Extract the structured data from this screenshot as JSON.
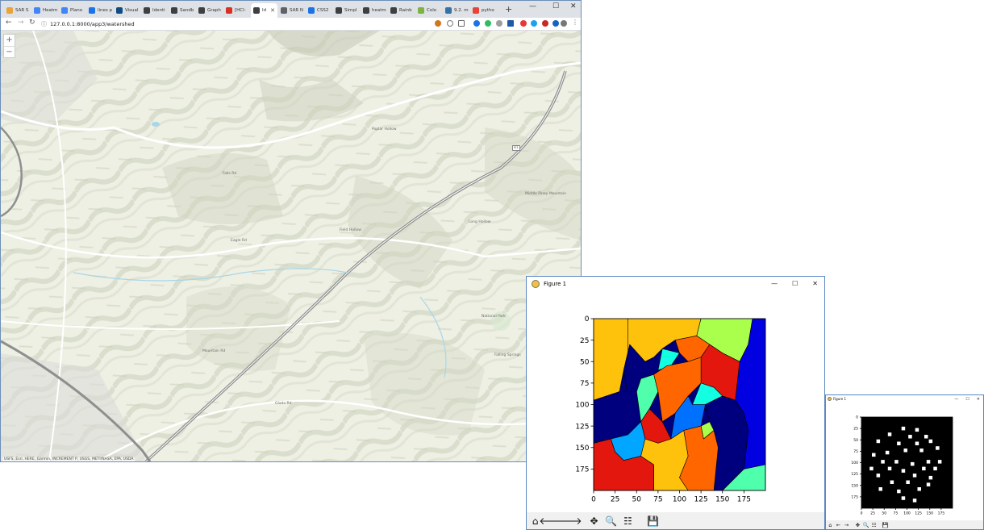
{
  "browser": {
    "tabs": [
      {
        "label": "SAR S",
        "color": "#e8a33b"
      },
      {
        "label": "Heatm",
        "color": "#4285f4"
      },
      {
        "label": "Plano",
        "color": "#4285f4"
      },
      {
        "label": "lines p",
        "color": "#1a73e8"
      },
      {
        "label": "Visual",
        "color": "#0f4c81"
      },
      {
        "label": "Identi",
        "color": "#3c4043"
      },
      {
        "label": "Sandb",
        "color": "#3c4043"
      },
      {
        "label": "Graph",
        "color": "#3c4043"
      },
      {
        "label": "[HCI-",
        "color": "#d93025"
      },
      {
        "label": "Id",
        "color": "#3c4043",
        "active": true
      },
      {
        "label": "SAR N",
        "color": "#5f6368"
      },
      {
        "label": "CSS2",
        "color": "#1a73e8"
      },
      {
        "label": "Simpl",
        "color": "#3c4043"
      },
      {
        "label": "heatm",
        "color": "#3c4043"
      },
      {
        "label": "Rainb",
        "color": "#3c4043"
      },
      {
        "label": "Colo",
        "color": "#7cb342"
      },
      {
        "label": "9.2. m",
        "color": "#3572a5"
      },
      {
        "label": "pytho",
        "color": "#ea4335"
      }
    ],
    "new_tab": "+",
    "window_controls": {
      "minimize": "—",
      "maximize": "☐",
      "close": "✕"
    },
    "nav": {
      "back": "←",
      "forward": "→",
      "reload": "↻"
    },
    "url": "127.0.0.1:8000/app3/watershed",
    "info_icon": "ⓘ"
  },
  "map": {
    "zoom_in": "+",
    "zoom_out": "−",
    "attribution": "USFS, Esri, HERE, Garmin, INCREMENT P, USGS, METI/NASA, EPA, USDA",
    "labels": {
      "poplar_hollow": "Poplar Hollow",
      "long_hollow": "Long Hollow",
      "field_hollow": "Field Hollow",
      "middle_piney": "Middle Piney Mountain",
      "falls_rd": "Falls Rd",
      "eagle_rd": "Eagle Rd",
      "nat_park": "National Park",
      "springs": "Falling Springs",
      "mtn_rd": "Mountain Rd",
      "glade_rd": "Glade Rd",
      "i81": "81"
    }
  },
  "figure_large": {
    "title": "Figure 1",
    "window_controls": {
      "minimize": "—",
      "maximize": "☐",
      "close": "✕"
    },
    "toolbar": {
      "home": "⌂",
      "back": "🡐",
      "forward": "🡒",
      "pan": "✥",
      "zoom": "🔍",
      "configure": "☷",
      "save": "💾"
    }
  },
  "figure_small": {
    "title": "Figure 1",
    "window_controls": {
      "minimize": "—",
      "maximize": "☐",
      "close": "✕"
    },
    "toolbar": {
      "home": "⌂",
      "back": "←",
      "forward": "→",
      "pan": "✥",
      "zoom": "🔍",
      "configure": "☷",
      "save": "💾"
    }
  },
  "chart_data": [
    {
      "type": "heatmap",
      "description_of_content": "watershed segmentation label image, jet colormap",
      "title": "",
      "xlabel": "",
      "ylabel": "",
      "xlim": [
        0,
        200
      ],
      "ylim": [
        200,
        0
      ],
      "xticks": [
        0,
        25,
        50,
        75,
        100,
        125,
        150,
        175
      ],
      "yticks": [
        0,
        25,
        50,
        75,
        100,
        125,
        150,
        175
      ],
      "regions": [
        {
          "color": "#fec20c",
          "polygon": [
            [
              0,
              0
            ],
            [
              40,
              0
            ],
            [
              42,
              30
            ],
            [
              35,
              60
            ],
            [
              30,
              85
            ],
            [
              0,
              95
            ]
          ]
        },
        {
          "color": "#fec20c",
          "polygon": [
            [
              40,
              0
            ],
            [
              125,
              0
            ],
            [
              120,
              20
            ],
            [
              95,
              25
            ],
            [
              80,
              35
            ],
            [
              70,
              45
            ],
            [
              60,
              50
            ],
            [
              40,
              40
            ]
          ]
        },
        {
          "color": "#aaff4d",
          "polygon": [
            [
              125,
              0
            ],
            [
              185,
              0
            ],
            [
              180,
              30
            ],
            [
              170,
              50
            ],
            [
              150,
              40
            ],
            [
              135,
              30
            ],
            [
              120,
              20
            ]
          ]
        },
        {
          "color": "#0000e0",
          "polygon": [
            [
              185,
              0
            ],
            [
              200,
              0
            ],
            [
              200,
              170
            ],
            [
              175,
              175
            ],
            [
              180,
              130
            ],
            [
              175,
              110
            ],
            [
              165,
              95
            ],
            [
              170,
              50
            ],
            [
              180,
              30
            ]
          ]
        },
        {
          "color": "#00007f",
          "polygon": [
            [
              42,
              30
            ],
            [
              60,
              50
            ],
            [
              70,
              45
            ],
            [
              80,
              35
            ],
            [
              95,
              25
            ],
            [
              100,
              40
            ],
            [
              85,
              55
            ],
            [
              70,
              65
            ],
            [
              55,
              70
            ],
            [
              50,
              85
            ],
            [
              40,
              90
            ],
            [
              35,
              60
            ]
          ]
        },
        {
          "color": "#ff6600",
          "polygon": [
            [
              95,
              25
            ],
            [
              120,
              20
            ],
            [
              135,
              30
            ],
            [
              125,
              45
            ],
            [
              110,
              50
            ],
            [
              100,
              40
            ]
          ]
        },
        {
          "color": "#e4170f",
          "polygon": [
            [
              135,
              30
            ],
            [
              150,
              40
            ],
            [
              170,
              50
            ],
            [
              165,
              95
            ],
            [
              150,
              90
            ],
            [
              140,
              80
            ],
            [
              125,
              75
            ],
            [
              125,
              45
            ]
          ]
        },
        {
          "color": "#14ffe2",
          "polygon": [
            [
              80,
              35
            ],
            [
              100,
              40
            ],
            [
              90,
              55
            ],
            [
              75,
              60
            ]
          ]
        },
        {
          "color": "#00007f",
          "polygon": [
            [
              0,
              95
            ],
            [
              30,
              85
            ],
            [
              50,
              85
            ],
            [
              55,
              120
            ],
            [
              40,
              135
            ],
            [
              20,
              140
            ],
            [
              0,
              145
            ]
          ]
        },
        {
          "color": "#4fffac",
          "polygon": [
            [
              50,
              85
            ],
            [
              55,
              70
            ],
            [
              70,
              65
            ],
            [
              75,
              85
            ],
            [
              65,
              105
            ],
            [
              55,
              120
            ]
          ]
        },
        {
          "color": "#ff6600",
          "polygon": [
            [
              70,
              65
            ],
            [
              85,
              55
            ],
            [
              110,
              50
            ],
            [
              125,
              45
            ],
            [
              125,
              75
            ],
            [
              110,
              90
            ],
            [
              95,
              110
            ],
            [
              80,
              120
            ],
            [
              75,
              85
            ]
          ]
        },
        {
          "color": "#14ffe2",
          "polygon": [
            [
              125,
              75
            ],
            [
              140,
              80
            ],
            [
              150,
              90
            ],
            [
              130,
              100
            ],
            [
              115,
              100
            ]
          ]
        },
        {
          "color": "#0070ff",
          "polygon": [
            [
              95,
              110
            ],
            [
              110,
              90
            ],
            [
              115,
              100
            ],
            [
              130,
              100
            ],
            [
              125,
              125
            ],
            [
              105,
              130
            ],
            [
              90,
              140
            ]
          ]
        },
        {
          "color": "#e4170f",
          "polygon": [
            [
              55,
              120
            ],
            [
              65,
              105
            ],
            [
              80,
              120
            ],
            [
              90,
              140
            ],
            [
              75,
              145
            ],
            [
              60,
              140
            ]
          ]
        },
        {
          "color": "#00007f",
          "polygon": [
            [
              150,
              90
            ],
            [
              165,
              95
            ],
            [
              175,
              110
            ],
            [
              180,
              130
            ],
            [
              175,
              175
            ],
            [
              150,
              200
            ],
            [
              140,
              200
            ],
            [
              145,
              150
            ],
            [
              135,
              120
            ],
            [
              130,
              100
            ]
          ]
        },
        {
          "color": "#4fffac",
          "polygon": [
            [
              175,
              175
            ],
            [
              200,
              170
            ],
            [
              200,
              200
            ],
            [
              150,
              200
            ]
          ]
        },
        {
          "color": "#aaff4d",
          "polygon": [
            [
              125,
              125
            ],
            [
              135,
              120
            ],
            [
              140,
              130
            ],
            [
              128,
              140
            ]
          ]
        },
        {
          "color": "#00a6ff",
          "polygon": [
            [
              20,
              140
            ],
            [
              40,
              135
            ],
            [
              55,
              120
            ],
            [
              60,
              140
            ],
            [
              55,
              160
            ],
            [
              35,
              165
            ],
            [
              25,
              155
            ]
          ]
        },
        {
          "color": "#e4170f",
          "polygon": [
            [
              0,
              145
            ],
            [
              20,
              140
            ],
            [
              25,
              155
            ],
            [
              35,
              165
            ],
            [
              55,
              160
            ],
            [
              70,
              170
            ],
            [
              70,
              200
            ],
            [
              0,
              200
            ]
          ]
        },
        {
          "color": "#fec20c",
          "polygon": [
            [
              60,
              140
            ],
            [
              75,
              145
            ],
            [
              90,
              140
            ],
            [
              105,
              130
            ],
            [
              110,
              160
            ],
            [
              100,
              185
            ],
            [
              110,
              200
            ],
            [
              70,
              200
            ],
            [
              70,
              170
            ],
            [
              55,
              160
            ]
          ]
        },
        {
          "color": "#ff6600",
          "polygon": [
            [
              105,
              130
            ],
            [
              125,
              125
            ],
            [
              128,
              140
            ],
            [
              140,
              130
            ],
            [
              145,
              150
            ],
            [
              140,
              200
            ],
            [
              110,
              200
            ],
            [
              100,
              185
            ],
            [
              110,
              160
            ]
          ]
        }
      ]
    },
    {
      "type": "heatmap",
      "description_of_content": "binary image with white square markers on black background",
      "title": "",
      "xlabel": "",
      "ylabel": "",
      "xlim": [
        0,
        200
      ],
      "ylim": [
        200,
        0
      ],
      "xticks": [
        0,
        25,
        50,
        75,
        100,
        125,
        150,
        175
      ],
      "yticks": [
        0,
        25,
        50,
        75,
        100,
        125,
        150,
        175
      ],
      "background": "#000000",
      "marker_color": "#ffffff",
      "marker_size": 8,
      "points": [
        [
          92,
          25
        ],
        [
          122,
          28
        ],
        [
          62,
          38
        ],
        [
          107,
          43
        ],
        [
          142,
          43
        ],
        [
          37,
          53
        ],
        [
          152,
          53
        ],
        [
          82,
          58
        ],
        [
          122,
          58
        ],
        [
          27,
          83
        ],
        [
          57,
          78
        ],
        [
          97,
          73
        ],
        [
          132,
          73
        ],
        [
          167,
          68
        ],
        [
          47,
          98
        ],
        [
          77,
          98
        ],
        [
          112,
          103
        ],
        [
          147,
          98
        ],
        [
          172,
          98
        ],
        [
          22,
          113
        ],
        [
          62,
          113
        ],
        [
          92,
          118
        ],
        [
          137,
          113
        ],
        [
          162,
          113
        ],
        [
          37,
          128
        ],
        [
          117,
          128
        ],
        [
          152,
          133
        ],
        [
          67,
          143
        ],
        [
          102,
          143
        ],
        [
          147,
          148
        ],
        [
          42,
          158
        ],
        [
          82,
          163
        ],
        [
          127,
          158
        ],
        [
          92,
          178
        ],
        [
          117,
          183
        ]
      ]
    }
  ]
}
